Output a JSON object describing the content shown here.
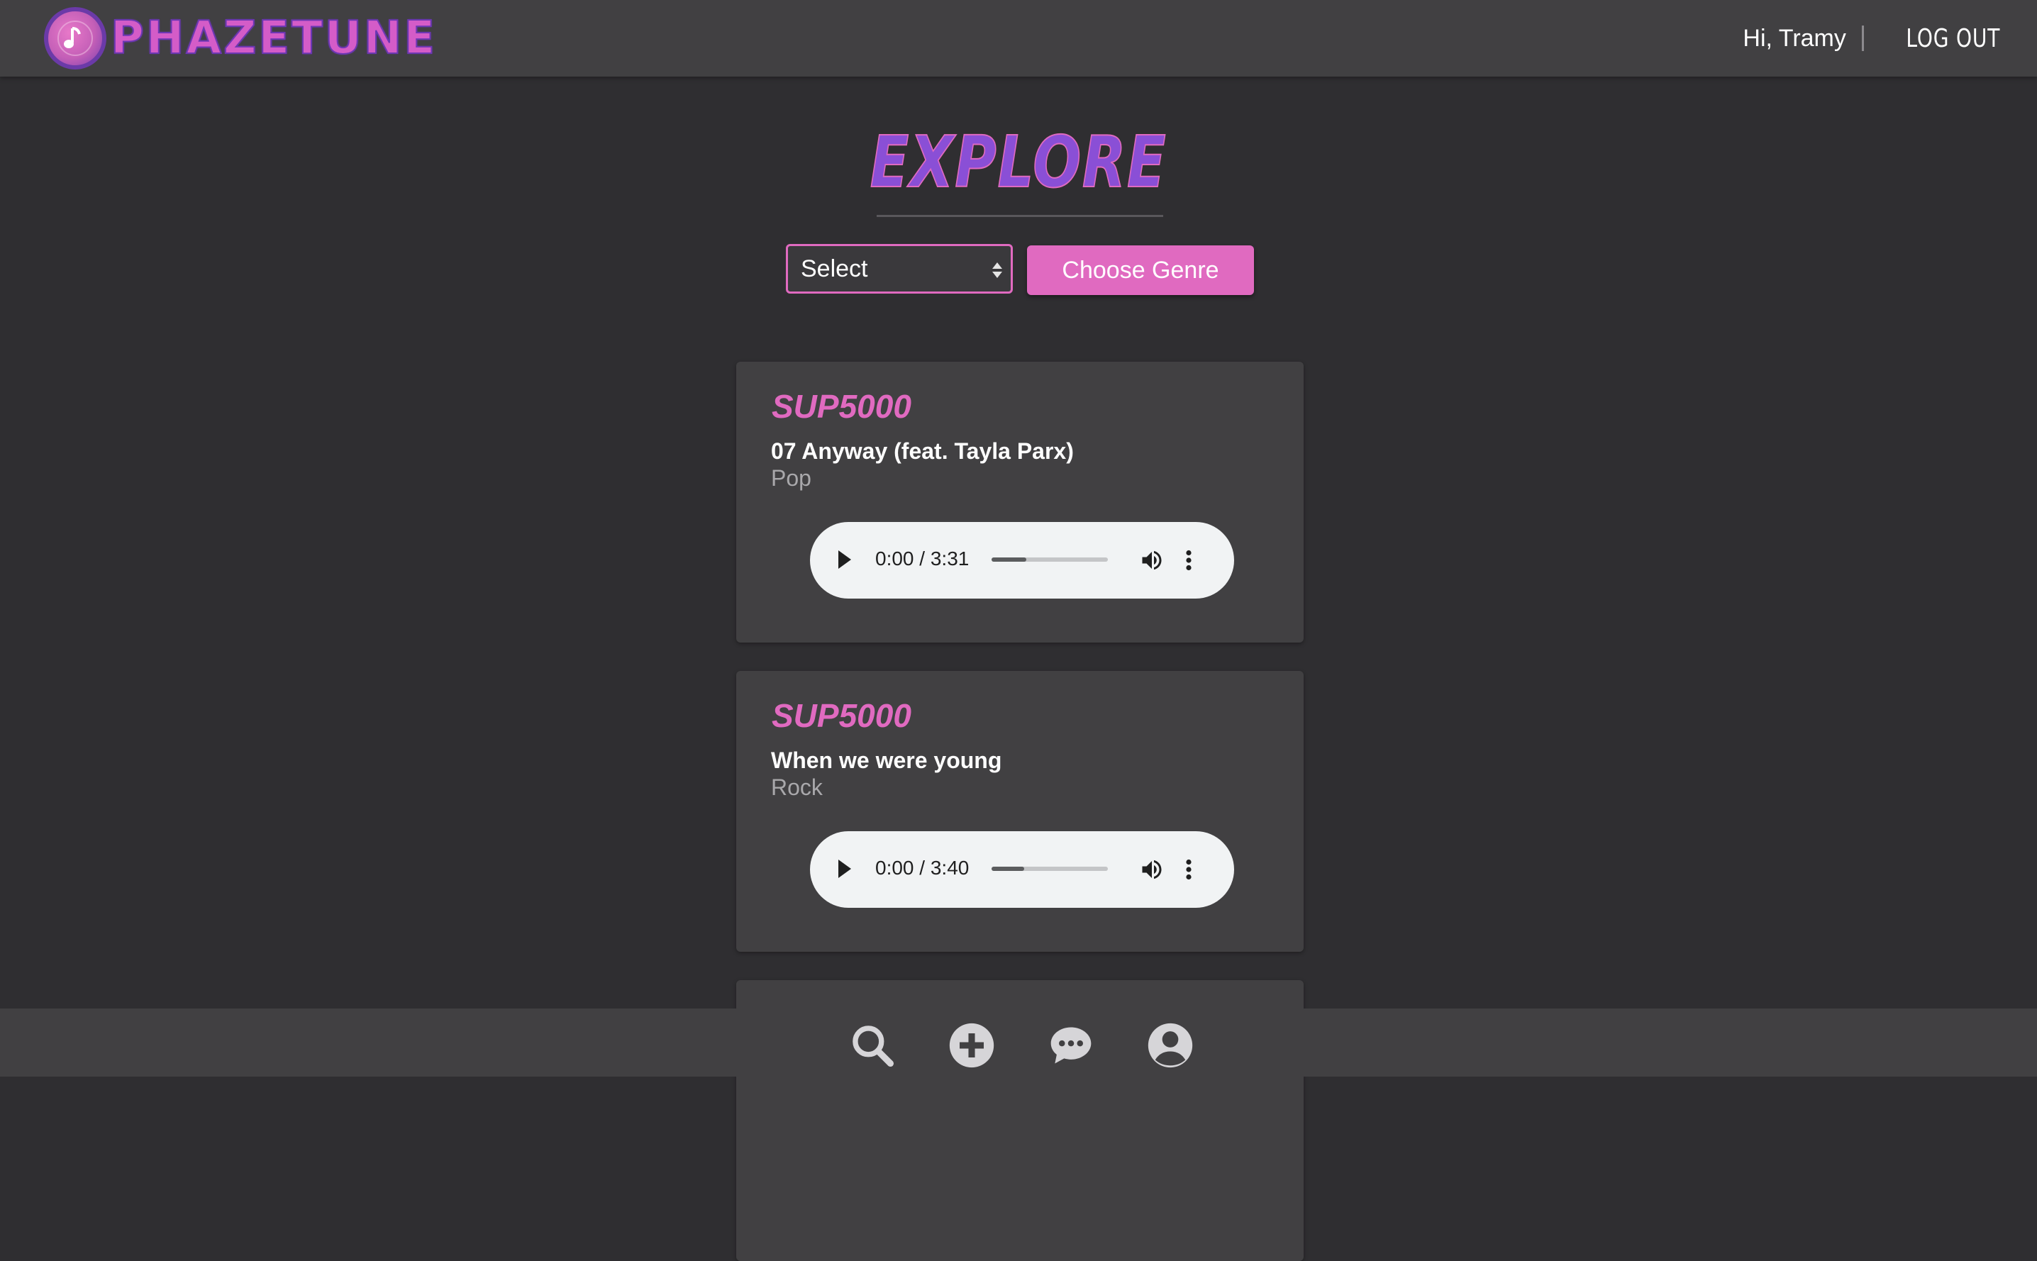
{
  "app": {
    "name": "PHAZETUNE",
    "accent_color": "#e06ac0",
    "logo_icon": "music-note-icon"
  },
  "header": {
    "greeting": "Hi, Tramy",
    "logout_label": "LOG OUT"
  },
  "page": {
    "title": "EXPLORE"
  },
  "genre_filter": {
    "select_value": "Select",
    "button_label": "Choose Genre"
  },
  "songs": [
    {
      "user": "SUP5000",
      "title": "07 Anyway (feat. Tayla Parx)",
      "genre": "Pop",
      "player": {
        "current": "0:00",
        "separator": " / ",
        "duration": "3:31",
        "progress": 0.3
      }
    },
    {
      "user": "SUP5000",
      "title": "When we were young",
      "genre": "Rock",
      "player": {
        "current": "0:00",
        "separator": " / ",
        "duration": "3:40",
        "progress": 0.28
      }
    }
  ],
  "bottom_nav": [
    {
      "icon": "search-icon"
    },
    {
      "icon": "add-circle-icon"
    },
    {
      "icon": "chat-bubble-icon"
    },
    {
      "icon": "account-circle-icon"
    }
  ]
}
